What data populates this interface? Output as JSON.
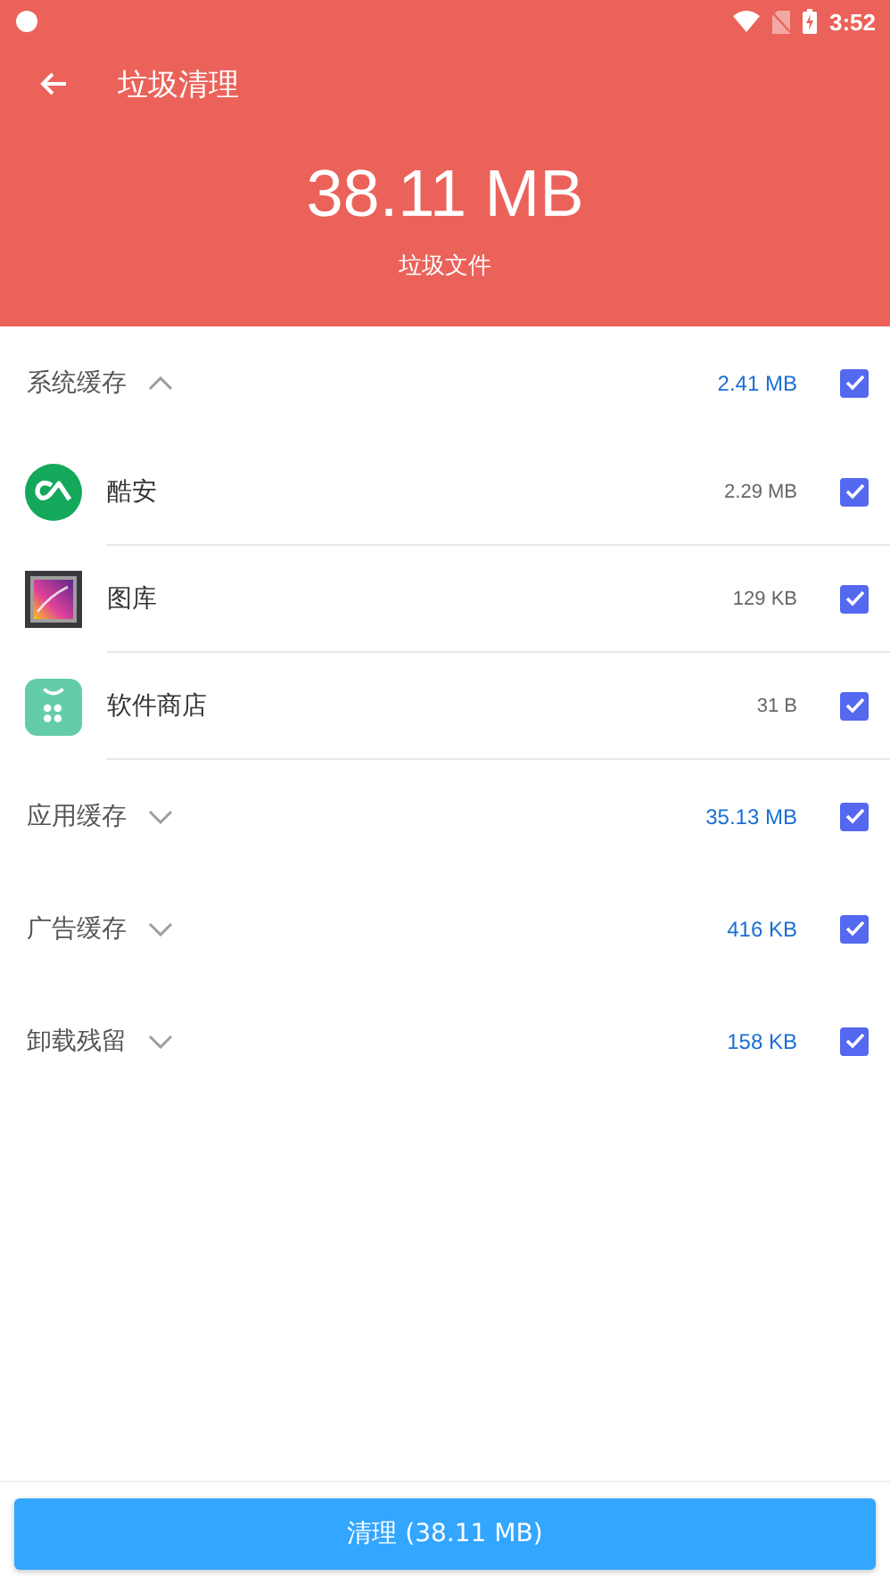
{
  "status_bar": {
    "time": "3:52"
  },
  "toolbar": {
    "title": "垃圾清理"
  },
  "summary": {
    "total": "38.11 MB",
    "caption": "垃圾文件"
  },
  "groups": [
    {
      "label": "系统缓存",
      "expanded": true,
      "size": "2.41 MB",
      "checked": true,
      "children": [
        {
          "name": "酷安",
          "size": "2.29 MB",
          "checked": true,
          "kind": "coolapk"
        },
        {
          "name": "图库",
          "size": "129 KB",
          "checked": true,
          "kind": "gallery"
        },
        {
          "name": "软件商店",
          "size": "31 B",
          "checked": true,
          "kind": "store"
        }
      ]
    },
    {
      "label": "应用缓存",
      "expanded": false,
      "size": "35.13 MB",
      "checked": true
    },
    {
      "label": "广告缓存",
      "expanded": false,
      "size": "416 KB",
      "checked": true
    },
    {
      "label": "卸载残留",
      "expanded": false,
      "size": "158 KB",
      "checked": true
    }
  ],
  "clean_button": "清理 (38.11 MB)"
}
